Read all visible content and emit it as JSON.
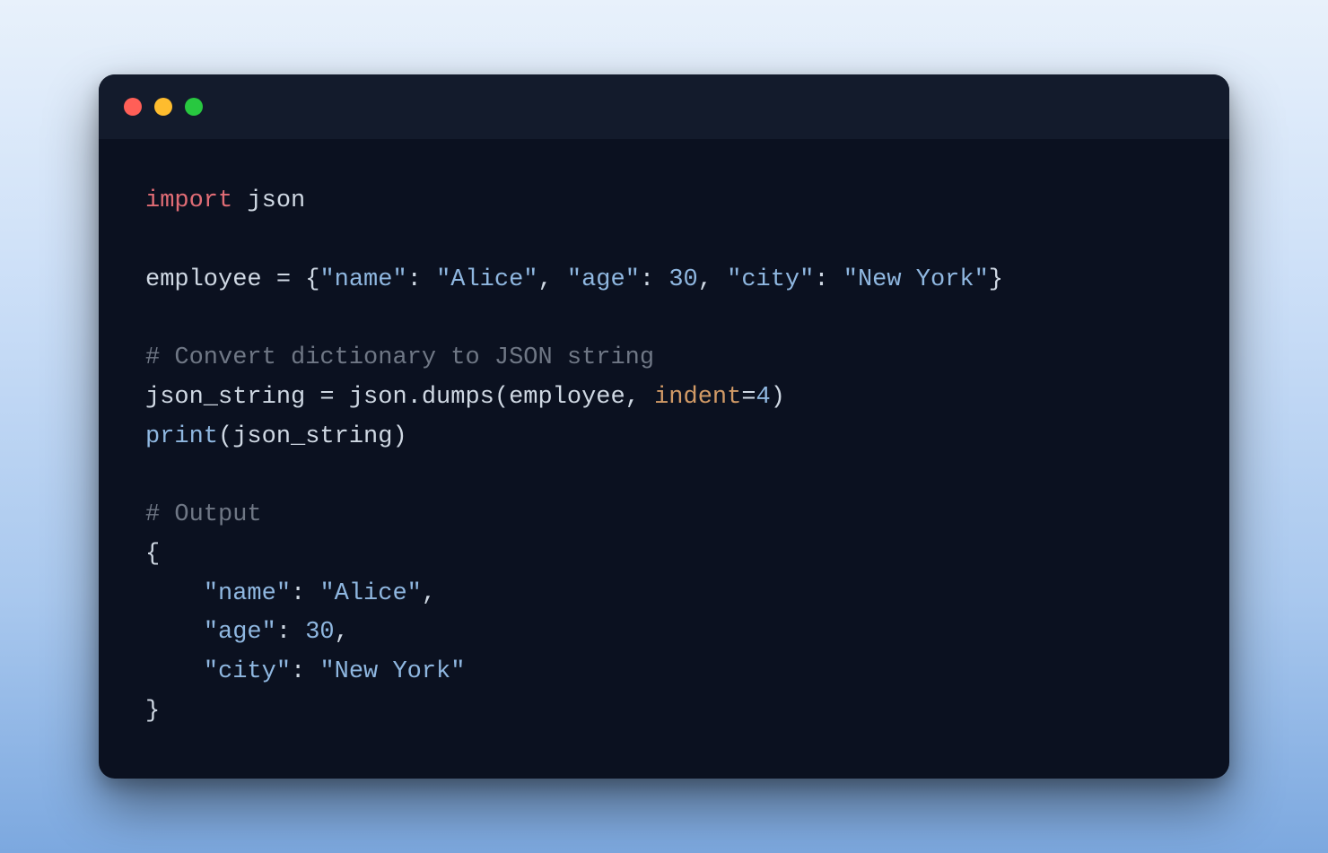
{
  "window": {
    "traffic_lights": [
      "close",
      "minimize",
      "zoom"
    ]
  },
  "code": {
    "lines": [
      [
        {
          "cls": "tok-keyword",
          "text": "import"
        },
        {
          "cls": "tok-default",
          "text": " json"
        }
      ],
      [],
      [
        {
          "cls": "tok-default",
          "text": "employee = {"
        },
        {
          "cls": "tok-string",
          "text": "\"name\""
        },
        {
          "cls": "tok-default",
          "text": ": "
        },
        {
          "cls": "tok-string",
          "text": "\"Alice\""
        },
        {
          "cls": "tok-default",
          "text": ", "
        },
        {
          "cls": "tok-string",
          "text": "\"age\""
        },
        {
          "cls": "tok-default",
          "text": ": "
        },
        {
          "cls": "tok-number",
          "text": "30"
        },
        {
          "cls": "tok-default",
          "text": ", "
        },
        {
          "cls": "tok-string",
          "text": "\"city\""
        },
        {
          "cls": "tok-default",
          "text": ": "
        },
        {
          "cls": "tok-string",
          "text": "\"New York\""
        },
        {
          "cls": "tok-default",
          "text": "}"
        }
      ],
      [],
      [
        {
          "cls": "tok-comment",
          "text": "# Convert dictionary to JSON string"
        }
      ],
      [
        {
          "cls": "tok-default",
          "text": "json_string = json.dumps(employee, "
        },
        {
          "cls": "tok-param",
          "text": "indent"
        },
        {
          "cls": "tok-default",
          "text": "="
        },
        {
          "cls": "tok-number",
          "text": "4"
        },
        {
          "cls": "tok-default",
          "text": ")"
        }
      ],
      [
        {
          "cls": "tok-func",
          "text": "print"
        },
        {
          "cls": "tok-default",
          "text": "(json_string)"
        }
      ],
      [],
      [
        {
          "cls": "tok-comment",
          "text": "# Output"
        }
      ],
      [
        {
          "cls": "tok-default",
          "text": "{"
        }
      ],
      [
        {
          "cls": "tok-default",
          "text": "    "
        },
        {
          "cls": "tok-string",
          "text": "\"name\""
        },
        {
          "cls": "tok-default",
          "text": ": "
        },
        {
          "cls": "tok-string",
          "text": "\"Alice\""
        },
        {
          "cls": "tok-default",
          "text": ","
        }
      ],
      [
        {
          "cls": "tok-default",
          "text": "    "
        },
        {
          "cls": "tok-string",
          "text": "\"age\""
        },
        {
          "cls": "tok-default",
          "text": ": "
        },
        {
          "cls": "tok-number",
          "text": "30"
        },
        {
          "cls": "tok-default",
          "text": ","
        }
      ],
      [
        {
          "cls": "tok-default",
          "text": "    "
        },
        {
          "cls": "tok-string",
          "text": "\"city\""
        },
        {
          "cls": "tok-default",
          "text": ": "
        },
        {
          "cls": "tok-string",
          "text": "\"New York\""
        }
      ],
      [
        {
          "cls": "tok-default",
          "text": "}"
        }
      ]
    ]
  }
}
